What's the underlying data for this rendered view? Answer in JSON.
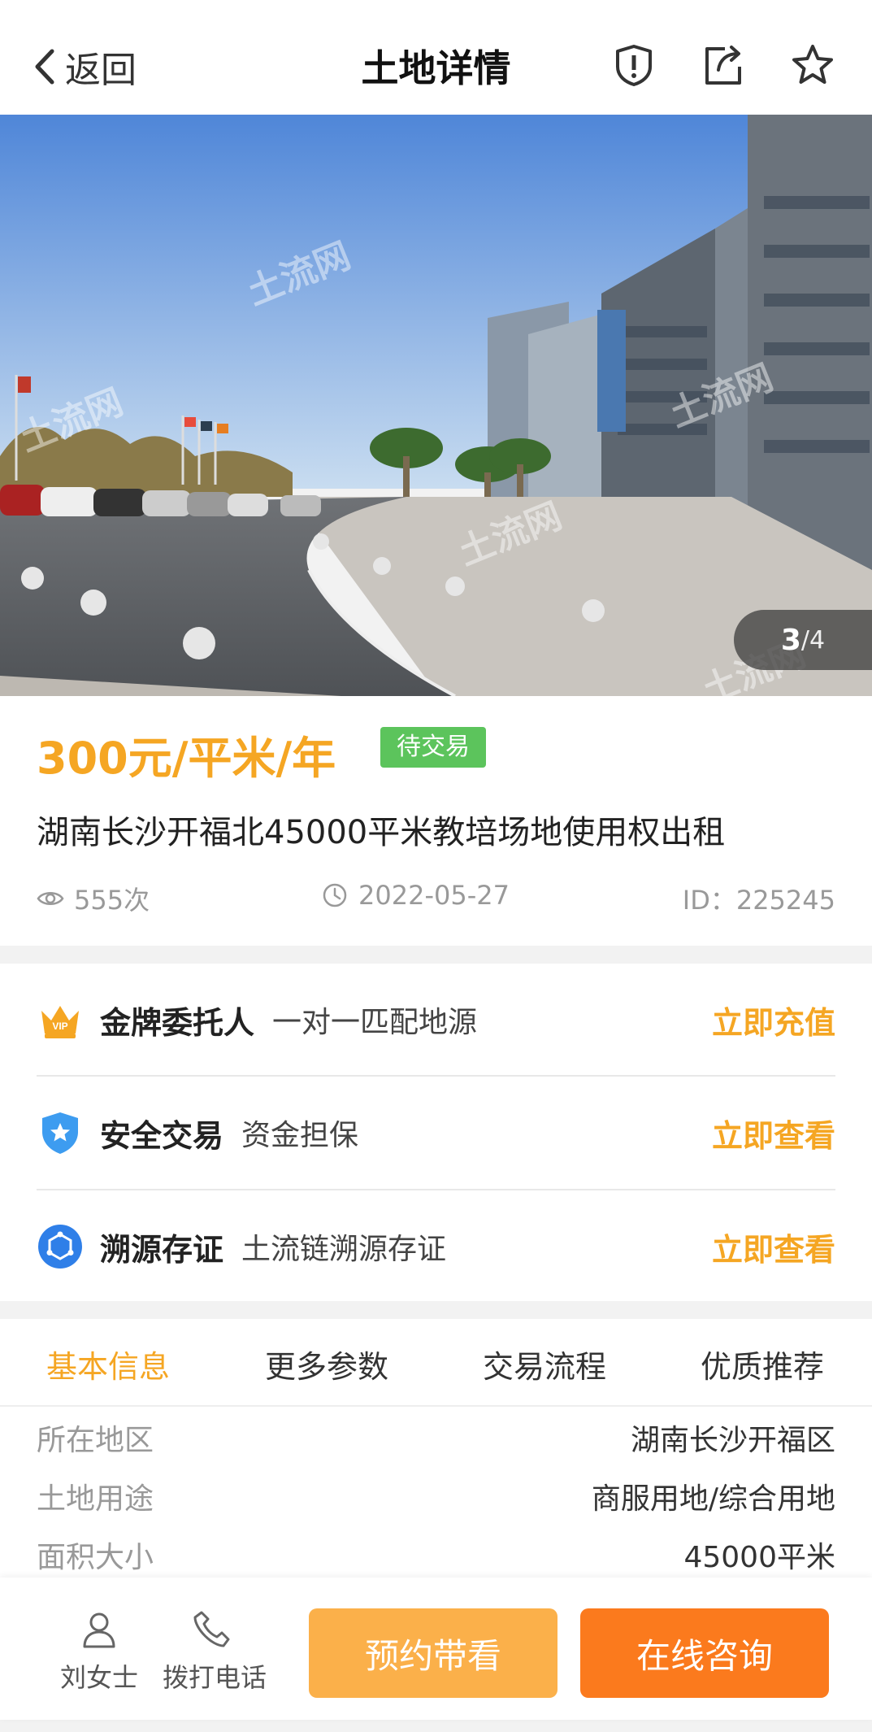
{
  "header": {
    "back_label": "返回",
    "title": "土地详情"
  },
  "gallery": {
    "current": "3",
    "total": "4",
    "watermark": "土流网"
  },
  "listing": {
    "price": "300元/平米/年",
    "status": "待交易",
    "title": "湖南长沙开福北45000平米教培场地使用权出租",
    "views": "555次",
    "date": "2022-05-27",
    "id": "ID：225245"
  },
  "services": [
    {
      "name": "金牌委托人",
      "desc": "一对一匹配地源",
      "action": "立即充值",
      "icon": "vip-crown-icon"
    },
    {
      "name": "安全交易",
      "desc": "资金担保",
      "action": "立即查看",
      "icon": "shield-star-icon"
    },
    {
      "name": "溯源存证",
      "desc": "土流链溯源存证",
      "action": "立即查看",
      "icon": "chain-icon"
    }
  ],
  "tabs": [
    "基本信息",
    "更多参数",
    "交易流程",
    "优质推荐"
  ],
  "details": [
    {
      "key": "所在地区",
      "value": "湖南长沙开福区"
    },
    {
      "key": "土地用途",
      "value": "商服用地/综合用地"
    },
    {
      "key": "面积大小",
      "value": "45000平米"
    }
  ],
  "bottom": {
    "contact_name": "刘女士",
    "call_label": "拨打电话",
    "appoint_label": "预约带看",
    "consult_label": "在线咨询"
  },
  "colors": {
    "accent": "#f5a623",
    "status_green": "#5cc45c",
    "consult_orange": "#fb7a1d",
    "appoint_orange": "#fbb04a"
  }
}
